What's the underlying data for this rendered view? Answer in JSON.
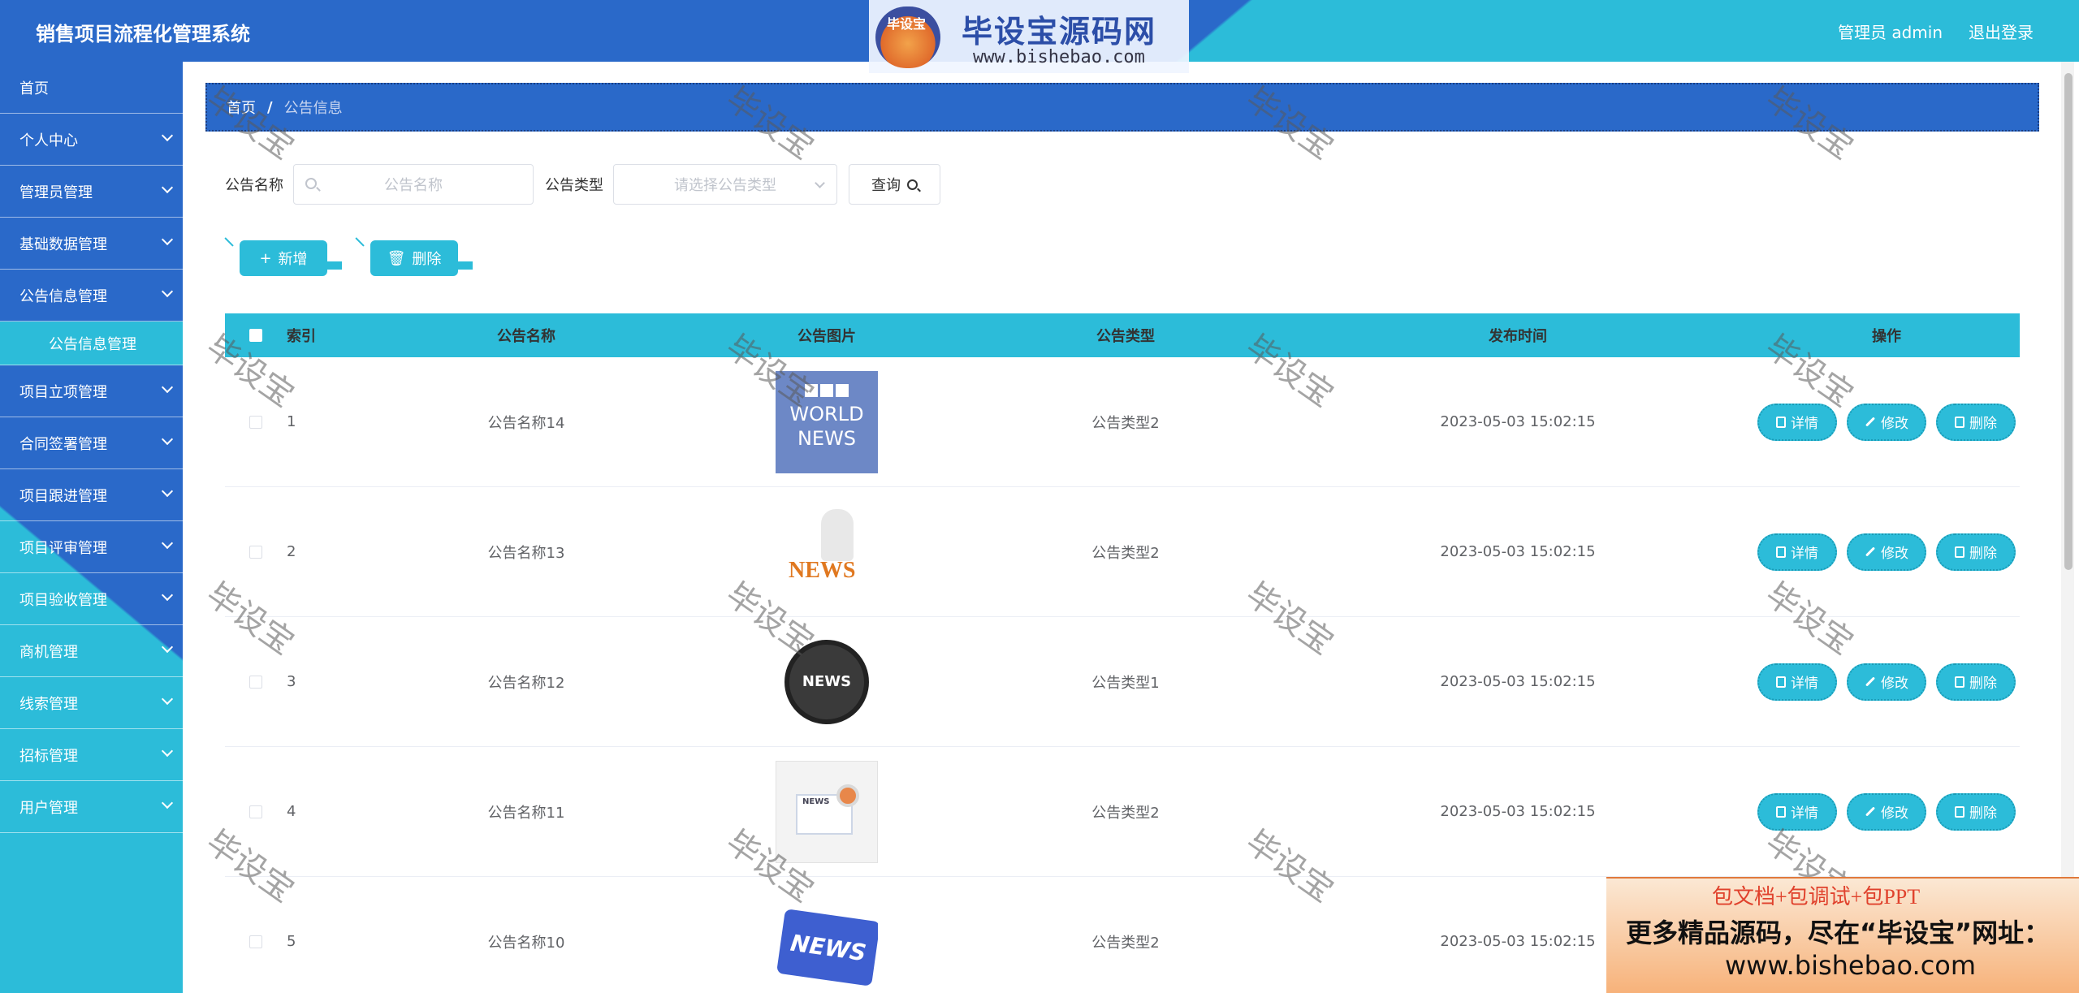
{
  "header": {
    "title": "销售项目流程化管理系统",
    "user_label": "管理员 admin",
    "logout_label": "退出登录"
  },
  "brand": {
    "badge": "毕设宝",
    "name": "毕设宝源码网",
    "url": "www.bishebao.com"
  },
  "sidebar": {
    "items": [
      {
        "label": "首页",
        "has_children": false
      },
      {
        "label": "个人中心",
        "has_children": true
      },
      {
        "label": "管理员管理",
        "has_children": true
      },
      {
        "label": "基础数据管理",
        "has_children": true
      },
      {
        "label": "公告信息管理",
        "has_children": true,
        "expanded": true
      },
      {
        "label": "项目立项管理",
        "has_children": true
      },
      {
        "label": "合同签署管理",
        "has_children": true
      },
      {
        "label": "项目跟进管理",
        "has_children": true
      },
      {
        "label": "项目评审管理",
        "has_children": true
      },
      {
        "label": "项目验收管理",
        "has_children": true
      },
      {
        "label": "商机管理",
        "has_children": true
      },
      {
        "label": "线索管理",
        "has_children": true
      },
      {
        "label": "招标管理",
        "has_children": true
      },
      {
        "label": "用户管理",
        "has_children": true
      }
    ],
    "submenu_active": "公告信息管理"
  },
  "breadcrumb": {
    "home": "首页",
    "separator": "/",
    "current": "公告信息"
  },
  "search": {
    "name_label": "公告名称",
    "name_placeholder": "公告名称",
    "type_label": "公告类型",
    "type_placeholder": "请选择公告类型",
    "query_label": "查询"
  },
  "actions": {
    "add_label": "新增",
    "delete_label": "删除"
  },
  "table": {
    "columns": [
      "索引",
      "公告名称",
      "公告图片",
      "公告类型",
      "发布时间",
      "操作"
    ],
    "op_labels": {
      "detail": "详情",
      "edit": "修改",
      "delete": "删除"
    },
    "rows": [
      {
        "index": "1",
        "name": "公告名称14",
        "image": "bbc-world-news-thumbnail",
        "type": "公告类型2",
        "time": "2023-05-03 15:02:15"
      },
      {
        "index": "2",
        "name": "公告名称13",
        "image": "figure-reading-news-thumbnail",
        "type": "公告类型2",
        "time": "2023-05-03 15:02:15"
      },
      {
        "index": "3",
        "name": "公告名称12",
        "image": "globe-news-badge-thumbnail",
        "type": "公告类型1",
        "time": "2023-05-03 15:02:15"
      },
      {
        "index": "4",
        "name": "公告名称11",
        "image": "newspaper-illustration-thumbnail",
        "type": "公告类型2",
        "time": "2023-05-03 15:02:15"
      },
      {
        "index": "5",
        "name": "公告名称10",
        "image": "news-keyboard-key-thumbnail",
        "type": "公告类型2",
        "time": "2023-05-03 15:02:15"
      }
    ]
  },
  "thumb_text": {
    "bbc_line1": "WORLD",
    "bbc_line2": "NEWS",
    "news_word": "NEWS",
    "paper_label": "NEWS"
  },
  "watermark": "毕设宝",
  "ad": {
    "line1": "包文档+包调试+包PPT",
    "line2": "更多精品源码，尽在“毕设宝”网址：",
    "line3": "www.bishebao.com"
  },
  "colors": {
    "primary_blue": "#2a69c9",
    "accent_cyan": "#2cbcd9"
  }
}
